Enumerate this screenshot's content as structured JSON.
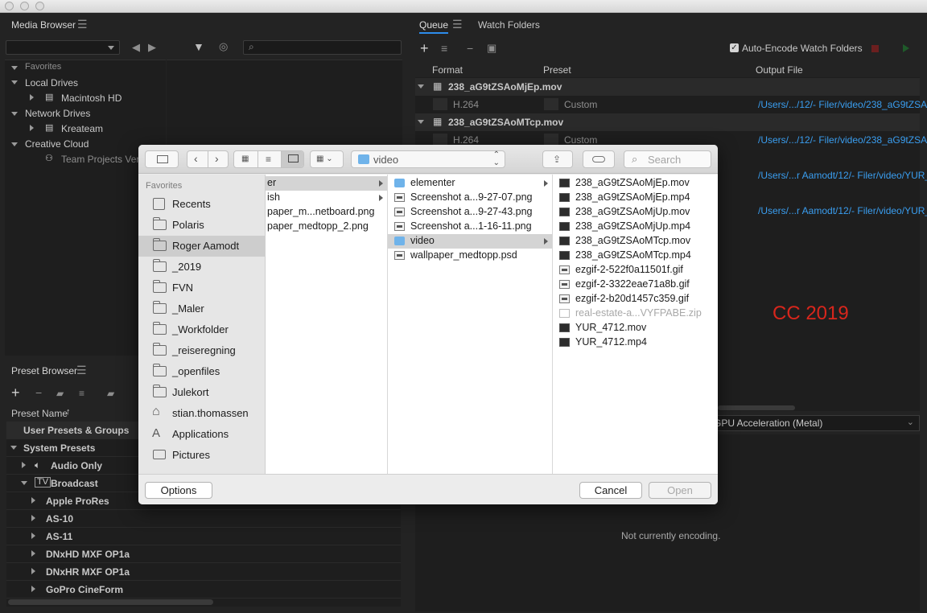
{
  "media_browser": {
    "title": "Media Browser",
    "tree": [
      {
        "label": "Favorites"
      },
      {
        "label": "Local Drives"
      },
      {
        "label": "Macintosh HD"
      },
      {
        "label": "Network Drives"
      },
      {
        "label": "Kreateam"
      },
      {
        "label": "Creative Cloud"
      },
      {
        "label": "Team Projects Versi"
      }
    ]
  },
  "preset_browser": {
    "title": "Preset Browser",
    "column_header": "Preset Name",
    "sort_indicator": "↑",
    "groups": [
      {
        "label": "User Presets & Groups"
      },
      {
        "label": "System Presets"
      },
      {
        "label": "Audio Only"
      },
      {
        "label": "Broadcast"
      },
      {
        "label": "Apple ProRes"
      },
      {
        "label": "AS-10"
      },
      {
        "label": "AS-11"
      },
      {
        "label": "DNxHD MXF OP1a"
      },
      {
        "label": "DNxHR MXF OP1a"
      },
      {
        "label": "GoPro CineForm"
      }
    ]
  },
  "queue": {
    "tab_queue": "Queue",
    "tab_watch": "Watch Folders",
    "auto_encode_label": "Auto-Encode Watch Folders",
    "col_format": "Format",
    "col_preset": "Preset",
    "col_output": "Output File",
    "items": [
      {
        "name": "238_aG9tZSAoMjEp.mov",
        "format": "H.264",
        "preset": "Custom",
        "output": "/Users/.../12/- Filer/video/238_aG9tZSAo"
      },
      {
        "name": "238_aG9tZSAoMTcp.mov",
        "format": "H.264",
        "preset": "Custom",
        "output": "/Users/.../12/- Filer/video/238_aG9tZSAo"
      }
    ],
    "extra_outputs": [
      "/Users/...r Aamodt/12/- Filer/video/YUR_",
      "/Users/...r Aamodt/12/- Filer/video/YUR_"
    ],
    "renderer": "GPU Acceleration (Metal)",
    "status": "Not currently encoding."
  },
  "overlay_label": "CC 2019",
  "dialog": {
    "path_popup": "video",
    "search_placeholder": "Search",
    "sidebar_header": "Favorites",
    "sidebar_items": [
      {
        "label": "Recents",
        "icon": "recents-icon"
      },
      {
        "label": "Polaris",
        "icon": "folder-icon"
      },
      {
        "label": "Roger Aamodt",
        "icon": "folder-icon"
      },
      {
        "label": "_2019",
        "icon": "folder-icon"
      },
      {
        "label": "FVN",
        "icon": "folder-icon"
      },
      {
        "label": "_Maler",
        "icon": "folder-icon"
      },
      {
        "label": "_Workfolder",
        "icon": "folder-icon"
      },
      {
        "label": "_reiseregning",
        "icon": "folder-icon"
      },
      {
        "label": "_openfiles",
        "icon": "folder-icon"
      },
      {
        "label": "Julekort",
        "icon": "folder-icon"
      },
      {
        "label": "stian.thomassen",
        "icon": "home-icon"
      },
      {
        "label": "Applications",
        "icon": "applications-icon"
      },
      {
        "label": "Pictures",
        "icon": "camera-icon"
      }
    ],
    "col1": [
      "er",
      "ish",
      "paper_m...netboard.png",
      "paper_medtopp_2.png"
    ],
    "col2": [
      "elementer",
      "Screenshot a...9-27-07.png",
      "Screenshot a...9-27-43.png",
      "Screenshot a...1-16-11.png",
      "video",
      "wallpaper_medtopp.psd"
    ],
    "col3": [
      "238_aG9tZSAoMjEp.mov",
      "238_aG9tZSAoMjEp.mp4",
      "238_aG9tZSAoMjUp.mov",
      "238_aG9tZSAoMjUp.mp4",
      "238_aG9tZSAoMTcp.mov",
      "238_aG9tZSAoMTcp.mp4",
      "ezgif-2-522f0a11501f.gif",
      "ezgif-2-3322eae71a8b.gif",
      "ezgif-2-b20d1457c359.gif",
      "real-estate-a...VYFPABE.zip",
      "YUR_4712.mov",
      "YUR_4712.mp4"
    ],
    "options_label": "Options",
    "cancel_label": "Cancel",
    "open_label": "Open"
  }
}
